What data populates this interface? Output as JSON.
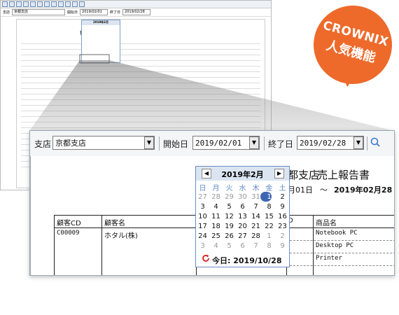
{
  "badge": {
    "line1": "CROWNIX",
    "line2": "人気機能"
  },
  "toolbar": {
    "branch_label": "支店",
    "branch_value": "京都支店",
    "start_label": "開始日",
    "start_value": "2019/02/01",
    "end_label": "終了日",
    "end_value": "2019/02/28"
  },
  "report": {
    "title_branch": "都支店",
    "title_main": "売上報告書",
    "date_from": "月01日",
    "date_sep": "～",
    "date_to": "2019年02月28",
    "headers": {
      "customer_cd": "顧客CD",
      "customer_name": "顧客名",
      "col_d": "D",
      "product_name": "商品名"
    },
    "rows": [
      {
        "cd": "C00009",
        "name": "ホタル(株)",
        "product": "Notebook PC"
      },
      {
        "product": "Desktop PC"
      },
      {
        "product": "Printer"
      }
    ]
  },
  "calendar": {
    "month_label": "2019年2月",
    "prev": "◀",
    "next": "▶",
    "weekdays": [
      "日",
      "月",
      "火",
      "水",
      "木",
      "金",
      "土"
    ],
    "weeks": [
      [
        "27",
        "28",
        "29",
        "30",
        "31",
        "1",
        "2"
      ],
      [
        "3",
        "4",
        "5",
        "6",
        "7",
        "8",
        "9"
      ],
      [
        "10",
        "11",
        "12",
        "13",
        "14",
        "15",
        "16"
      ],
      [
        "17",
        "18",
        "19",
        "20",
        "21",
        "22",
        "23"
      ],
      [
        "24",
        "25",
        "26",
        "27",
        "28",
        "1",
        "2"
      ],
      [
        "3",
        "4",
        "5",
        "6",
        "7",
        "8",
        "9"
      ]
    ],
    "today_label": "今日: 2019/10/28"
  },
  "colors": {
    "accent": "#ee6a2b",
    "calendar_header": "#dbe5f2",
    "selected": "#3d66b2",
    "weekday": "#5f88c6"
  }
}
